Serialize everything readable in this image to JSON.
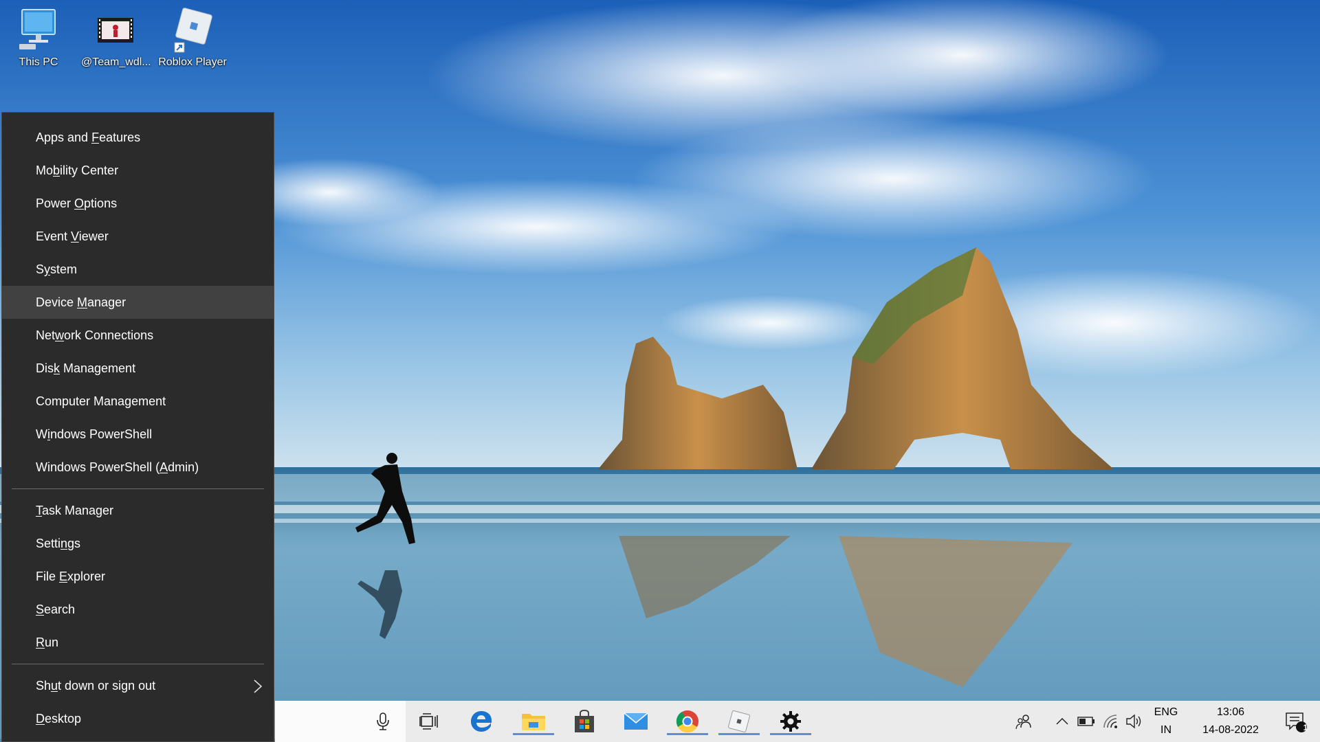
{
  "desktop": {
    "icons": [
      {
        "label": "This PC",
        "icon": "this-pc-icon"
      },
      {
        "label": "@Team_wdl...",
        "icon": "video-shortcut-icon"
      },
      {
        "label": "Roblox Player",
        "icon": "roblox-icon"
      }
    ]
  },
  "winx_menu": {
    "group1": [
      {
        "pre": "Apps and ",
        "ul": "F",
        "post": "eatures"
      },
      {
        "pre": "Mo",
        "ul": "b",
        "post": "ility Center"
      },
      {
        "pre": "Power ",
        "ul": "O",
        "post": "ptions"
      },
      {
        "pre": "Event ",
        "ul": "V",
        "post": "iewer"
      },
      {
        "pre": "S",
        "ul": "y",
        "post": "stem"
      },
      {
        "pre": "Device ",
        "ul": "M",
        "post": "anager"
      },
      {
        "pre": "Net",
        "ul": "w",
        "post": "ork Connections"
      },
      {
        "pre": "Dis",
        "ul": "k",
        "post": " Management"
      },
      {
        "pre": "Computer Mana",
        "ul": "g",
        "post": "ement"
      },
      {
        "pre": "W",
        "ul": "i",
        "post": "ndows PowerShell"
      },
      {
        "pre": "Windows PowerShell (",
        "ul": "A",
        "post": "dmin)"
      }
    ],
    "group2": [
      {
        "pre": "",
        "ul": "T",
        "post": "ask Manager"
      },
      {
        "pre": "Setti",
        "ul": "n",
        "post": "gs"
      },
      {
        "pre": "File ",
        "ul": "E",
        "post": "xplorer"
      },
      {
        "pre": "",
        "ul": "S",
        "post": "earch"
      },
      {
        "pre": "",
        "ul": "R",
        "post": "un"
      }
    ],
    "group3": [
      {
        "pre": "Sh",
        "ul": "u",
        "post": "t down or sign out",
        "submenu_icon": "chevron-right-icon"
      },
      {
        "pre": "",
        "ul": "D",
        "post": "esktop"
      }
    ],
    "highlighted": "Device Manager"
  },
  "taskbar": {
    "icons": [
      "microphone-icon",
      "task-view-icon",
      "edge-icon",
      "file-explorer-icon",
      "store-icon",
      "mail-icon",
      "chrome-icon",
      "roblox-icon",
      "settings-icon"
    ],
    "tray": {
      "lang_top": "ENG",
      "lang_bottom": "IN",
      "time": "13:06",
      "date": "14-08-2022",
      "notification_count": "1"
    }
  },
  "colors": {
    "menu_bg": "#2b2b2b",
    "menu_hover": "#414141",
    "taskbar_bg": "#ebebeb",
    "running_indicator": "#5b8fd2"
  }
}
